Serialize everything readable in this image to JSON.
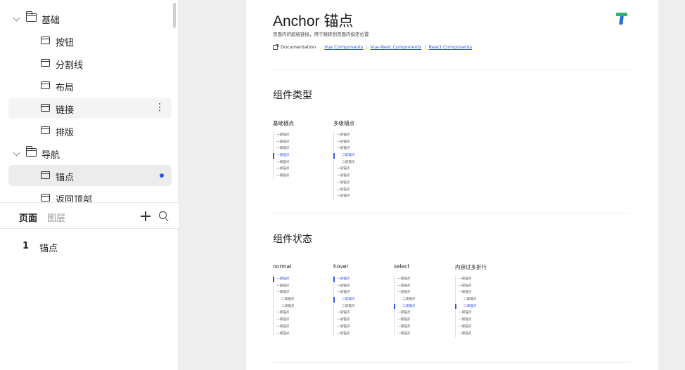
{
  "sidebar": {
    "tree": [
      {
        "type": "group",
        "label": "基础",
        "state": ""
      },
      {
        "type": "item",
        "label": "按钮",
        "state": ""
      },
      {
        "type": "item",
        "label": "分割线",
        "state": ""
      },
      {
        "type": "item",
        "label": "布局",
        "state": ""
      },
      {
        "type": "item",
        "label": "链接",
        "state": "hover"
      },
      {
        "type": "item",
        "label": "排版",
        "state": ""
      },
      {
        "type": "group",
        "label": "导航",
        "state": ""
      },
      {
        "type": "item",
        "label": "锚点",
        "state": "active"
      },
      {
        "type": "item",
        "label": "返回顶部",
        "state": ""
      }
    ],
    "more_glyph": "⋮",
    "tabs": {
      "pages": "页面",
      "layers": "图层"
    },
    "pages": [
      {
        "num": "1",
        "name": "锚点"
      }
    ]
  },
  "doc": {
    "title": "Anchor 锚点",
    "subtitle": "页面内的超级链接，用于跳转到页面内指定位置",
    "links": {
      "documentation": "Documentation",
      "vue": "Vue Components",
      "vue_next": "Vue-Next Components",
      "react": "React Components",
      "separator": "|"
    },
    "section_types": {
      "title": "组件类型",
      "demos": [
        {
          "label": "基础锚点",
          "items": [
            {
              "text": "一级锚点",
              "level": 1,
              "state": ""
            },
            {
              "text": "一级锚点",
              "level": 1,
              "state": ""
            },
            {
              "text": "一级锚点",
              "level": 1,
              "state": ""
            },
            {
              "text": "一级锚点",
              "level": 1,
              "state": "active"
            },
            {
              "text": "一级锚点",
              "level": 1,
              "state": ""
            },
            {
              "text": "一级锚点",
              "level": 1,
              "state": ""
            },
            {
              "text": "一级锚点",
              "level": 1,
              "state": ""
            }
          ]
        },
        {
          "label": "多级锚点",
          "items": [
            {
              "text": "一级锚点",
              "level": 1,
              "state": ""
            },
            {
              "text": "一级锚点",
              "level": 1,
              "state": ""
            },
            {
              "text": "一级锚点",
              "level": 1,
              "state": ""
            },
            {
              "text": "二级锚点",
              "level": 2,
              "state": "active"
            },
            {
              "text": "二级锚点",
              "level": 2,
              "state": ""
            },
            {
              "text": "一级锚点",
              "level": 1,
              "state": ""
            },
            {
              "text": "一级锚点",
              "level": 1,
              "state": ""
            },
            {
              "text": "一级锚点",
              "level": 1,
              "state": ""
            },
            {
              "text": "一级锚点",
              "level": 1,
              "state": ""
            },
            {
              "text": "一级锚点",
              "level": 1,
              "state": ""
            }
          ]
        }
      ]
    },
    "section_states": {
      "title": "组件状态",
      "demos": [
        {
          "label": "normal",
          "items": [
            {
              "text": "一级锚点",
              "level": 1,
              "state": "active"
            },
            {
              "text": "一级锚点",
              "level": 1,
              "state": ""
            },
            {
              "text": "一级锚点",
              "level": 1,
              "state": ""
            },
            {
              "text": "二级锚点",
              "level": 2,
              "state": ""
            },
            {
              "text": "二级锚点",
              "level": 2,
              "state": ""
            },
            {
              "text": "一级锚点",
              "level": 1,
              "state": ""
            },
            {
              "text": "一级锚点",
              "level": 1,
              "state": ""
            },
            {
              "text": "一级锚点",
              "level": 1,
              "state": ""
            },
            {
              "text": "一级锚点",
              "level": 1,
              "state": ""
            }
          ]
        },
        {
          "label": "hover",
          "items": [
            {
              "text": "一级锚点",
              "level": 1,
              "state": "active"
            },
            {
              "text": "一级锚点",
              "level": 1,
              "state": ""
            },
            {
              "text": "一级锚点",
              "level": 1,
              "state": ""
            },
            {
              "text": "二级锚点",
              "level": 2,
              "state": "active"
            },
            {
              "text": "二级锚点",
              "level": 2,
              "state": ""
            },
            {
              "text": "一级锚点",
              "level": 1,
              "state": ""
            },
            {
              "text": "一级锚点",
              "level": 1,
              "state": ""
            },
            {
              "text": "一级锚点",
              "level": 1,
              "state": ""
            },
            {
              "text": "一级锚点",
              "level": 1,
              "state": ""
            }
          ]
        },
        {
          "label": "select",
          "items": [
            {
              "text": "一级锚点",
              "level": 1,
              "state": ""
            },
            {
              "text": "一级锚点",
              "level": 1,
              "state": ""
            },
            {
              "text": "一级锚点",
              "level": 1,
              "state": ""
            },
            {
              "text": "二级锚点",
              "level": 2,
              "state": ""
            },
            {
              "text": "二级锚点",
              "level": 2,
              "state": "active"
            },
            {
              "text": "一级锚点",
              "level": 1,
              "state": ""
            },
            {
              "text": "一级锚点",
              "level": 1,
              "state": ""
            },
            {
              "text": "一级锚点",
              "level": 1,
              "state": ""
            },
            {
              "text": "一级锚点",
              "level": 1,
              "state": ""
            }
          ]
        },
        {
          "label": "内容过多折行",
          "items": [
            {
              "text": "一级锚点",
              "level": 1,
              "state": ""
            },
            {
              "text": "一级锚点",
              "level": 1,
              "state": ""
            },
            {
              "text": "一级锚点",
              "level": 1,
              "state": ""
            },
            {
              "text": "二级锚点",
              "level": 2,
              "state": ""
            },
            {
              "text": "二级锚点",
              "level": 2,
              "state": "active"
            },
            {
              "text": "一级锚点",
              "level": 1,
              "state": ""
            },
            {
              "text": "一级锚点",
              "level": 1,
              "state": ""
            },
            {
              "text": "一级锚点",
              "level": 1,
              "state": ""
            },
            {
              "text": "一级锚点",
              "level": 1,
              "state": ""
            }
          ]
        }
      ]
    }
  },
  "colors": {
    "accent": "#2f54eb",
    "logo_green": "#2fb26b",
    "logo_blue": "#1f6fd6"
  }
}
